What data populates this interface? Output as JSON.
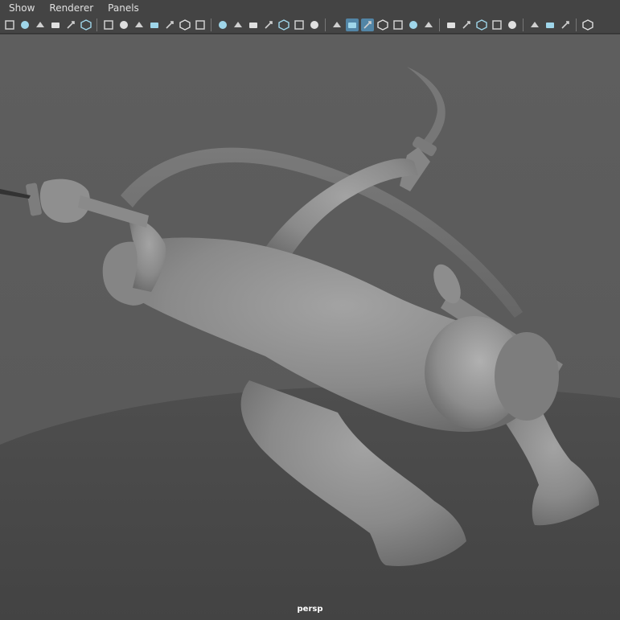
{
  "menus": [
    "Show",
    "Renderer",
    "Panels"
  ],
  "toolbar": {
    "icons": [
      "select-camera-icon",
      "lock-camera-icon",
      "camera-attributes-icon",
      "bookmark-icon",
      "image-plane-icon",
      "snapshot-icon",
      "sep",
      "2d-pan-zoom-icon",
      "grease-pencil-icon",
      "camera-toggle-icon",
      "film-gate-icon",
      "pencil-icon",
      "stylus-icon",
      "brush-icon",
      "sep",
      "grid-icon",
      "film-gate-frame-icon",
      "resolution-gate-icon",
      "gate-mask-icon",
      "field-chart-icon",
      "safe-action-icon",
      "safe-title-icon",
      "sep",
      "wireframe-icon",
      "smooth-shade-icon",
      "wireframe-on-shaded-icon",
      "textured-icon",
      "use-all-lights-icon",
      "shadows-icon",
      "ambient-occlusion-icon",
      "sep",
      "motion-blur-icon",
      "multisample-aa-icon",
      "depth-of-field-icon",
      "xray-icon",
      "isolate-select-icon",
      "sep",
      "xray-joints-icon",
      "xray-components-icon",
      "display-layers-icon",
      "sep",
      "hud-icon"
    ],
    "active": [
      "smooth-shade-icon",
      "wireframe-on-shaded-icon"
    ]
  },
  "viewport": {
    "camera_label": "persp",
    "background_color": "#5d5d5d",
    "ground_color": "#4a4a4a",
    "model_color": "#8a8a8a"
  }
}
